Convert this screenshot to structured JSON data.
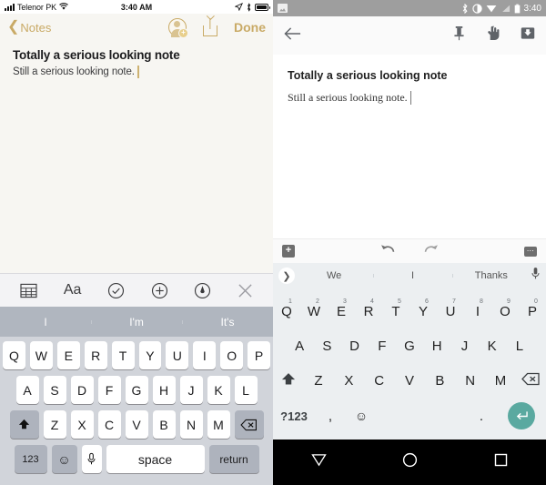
{
  "ios": {
    "status": {
      "carrier": "Telenor PK",
      "time": "3:40 AM",
      "signal_icon": "signal-bars-icon",
      "wifi_icon": "wifi-icon",
      "location_icon": "location-arrow-icon",
      "bluetooth_icon": "bluetooth-icon",
      "battery_icon": "battery-icon"
    },
    "nav": {
      "back_label": "Notes",
      "back_icon": "chevron-left-icon",
      "add_person_icon": "add-person-icon",
      "share_icon": "share-icon",
      "done_label": "Done",
      "accent_color": "#c9aa66"
    },
    "note": {
      "title": "Totally a serious looking note",
      "body": "Still a serious looking note.",
      "background_color": "#f7f6f2"
    },
    "toolbar": {
      "items": [
        {
          "name": "table-icon",
          "label": "Table"
        },
        {
          "name": "text-format-icon",
          "label": "Aa"
        },
        {
          "name": "checklist-icon",
          "label": "Checklist"
        },
        {
          "name": "add-attachment-icon",
          "label": "Add"
        },
        {
          "name": "markup-pen-icon",
          "label": "Markup"
        },
        {
          "name": "close-icon",
          "label": "Close"
        }
      ]
    },
    "predictions": [
      "I",
      "I'm",
      "It's"
    ],
    "keyboard": {
      "row1": [
        "Q",
        "W",
        "E",
        "R",
        "T",
        "Y",
        "U",
        "I",
        "O",
        "P"
      ],
      "row2": [
        "A",
        "S",
        "D",
        "F",
        "G",
        "H",
        "J",
        "K",
        "L"
      ],
      "row3": [
        "Z",
        "X",
        "C",
        "V",
        "B",
        "N",
        "M"
      ],
      "shift_icon": "shift-up-arrow-icon",
      "backspace_icon": "backspace-icon",
      "numeric_label": "123",
      "emoji_icon": "emoji-smiley-icon",
      "mic_icon": "microphone-icon",
      "space_label": "space",
      "return_label": "return"
    }
  },
  "android": {
    "status": {
      "screenshot_icon": "screenshot-notification-icon",
      "bluetooth_icon": "bluetooth-icon",
      "dnd_icon": "do-not-disturb-icon",
      "wifi_icon": "wifi-icon",
      "signal_icon": "cell-signal-icon",
      "battery_icon": "battery-icon",
      "time": "3:40"
    },
    "toolbar": {
      "back_icon": "back-arrow-icon",
      "pin_icon": "pin-icon",
      "reminder_hand_icon": "hand-pointer-icon",
      "archive_icon": "archive-down-icon"
    },
    "note": {
      "title": "Totally a serious looking note",
      "body": "Still a serious looking note."
    },
    "bottombar": {
      "add_icon": "add-plus-box-icon",
      "undo_icon": "undo-icon",
      "redo_icon": "redo-icon",
      "more_icon": "more-options-icon"
    },
    "suggestions": {
      "expand_icon": "chevron-right-icon",
      "items": [
        "We",
        "I",
        "Thanks"
      ],
      "mic_icon": "microphone-icon"
    },
    "keyboard": {
      "row1": [
        {
          "key": "Q",
          "num": "1"
        },
        {
          "key": "W",
          "num": "2"
        },
        {
          "key": "E",
          "num": "3"
        },
        {
          "key": "R",
          "num": "4"
        },
        {
          "key": "T",
          "num": "5"
        },
        {
          "key": "Y",
          "num": "6"
        },
        {
          "key": "U",
          "num": "7"
        },
        {
          "key": "I",
          "num": "8"
        },
        {
          "key": "O",
          "num": "9"
        },
        {
          "key": "P",
          "num": "0"
        }
      ],
      "row2": [
        "A",
        "S",
        "D",
        "F",
        "G",
        "H",
        "J",
        "K",
        "L"
      ],
      "row3": [
        "Z",
        "X",
        "C",
        "V",
        "B",
        "N",
        "M"
      ],
      "shift_icon": "shift-up-arrow-icon",
      "backspace_icon": "backspace-icon",
      "symbols_label": "?123",
      "comma_label": ",",
      "emoji_icon": "emoji-smiley-icon",
      "period_label": ".",
      "enter_icon": "enter-return-icon",
      "enter_color": "#5aa9a0"
    },
    "navbar": {
      "back_icon": "nav-back-triangle-icon",
      "home_icon": "nav-home-circle-icon",
      "recents_icon": "nav-recents-square-icon"
    }
  }
}
